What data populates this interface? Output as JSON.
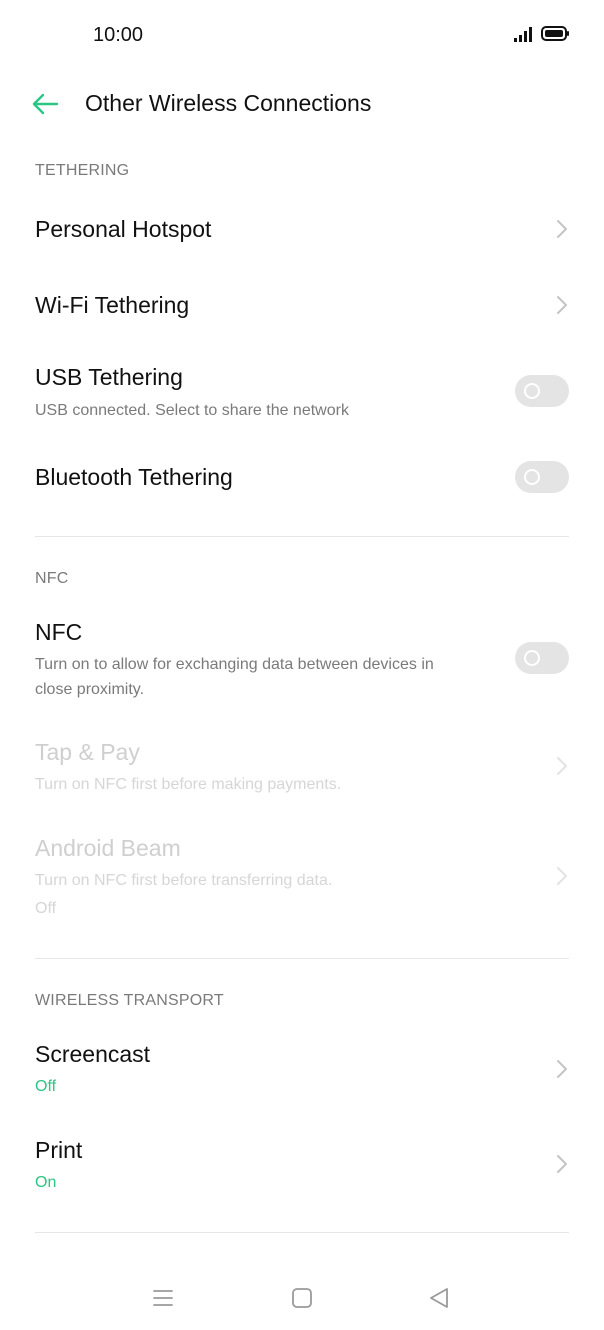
{
  "status_bar": {
    "time": "10:00",
    "signal_icon": "signal-icon",
    "battery_icon": "battery-icon"
  },
  "header": {
    "title": "Other Wireless Connections",
    "back_icon": "back-arrow-icon"
  },
  "accent_color": "#2bc584",
  "sections": {
    "tethering": {
      "label": "TETHERING",
      "items": [
        {
          "title": "Personal Hotspot"
        },
        {
          "title": "Wi-Fi Tethering"
        },
        {
          "title": "USB Tethering",
          "subtitle": "USB connected. Select to share the network",
          "toggle": "off"
        },
        {
          "title": "Bluetooth Tethering",
          "toggle": "off"
        }
      ]
    },
    "nfc": {
      "label": "NFC",
      "items": [
        {
          "title": "NFC",
          "subtitle_line1": "Turn on to allow for exchanging data between devices in",
          "subtitle_line2": "close proximity.",
          "toggle": "off"
        },
        {
          "title": "Tap & Pay",
          "subtitle": "Turn on NFC first before making payments.",
          "disabled": true
        },
        {
          "title": "Android Beam",
          "subtitle": "Turn on NFC first before transferring data.",
          "status": "Off",
          "disabled": true
        }
      ]
    },
    "wireless_transport": {
      "label": "WIRELESS TRANSPORT",
      "items": [
        {
          "title": "Screencast",
          "status": "Off"
        },
        {
          "title": "Print",
          "status": "On"
        }
      ]
    }
  },
  "nav_bar": {
    "icons": [
      "menu-icon",
      "home-icon",
      "back-triangle-icon"
    ]
  }
}
